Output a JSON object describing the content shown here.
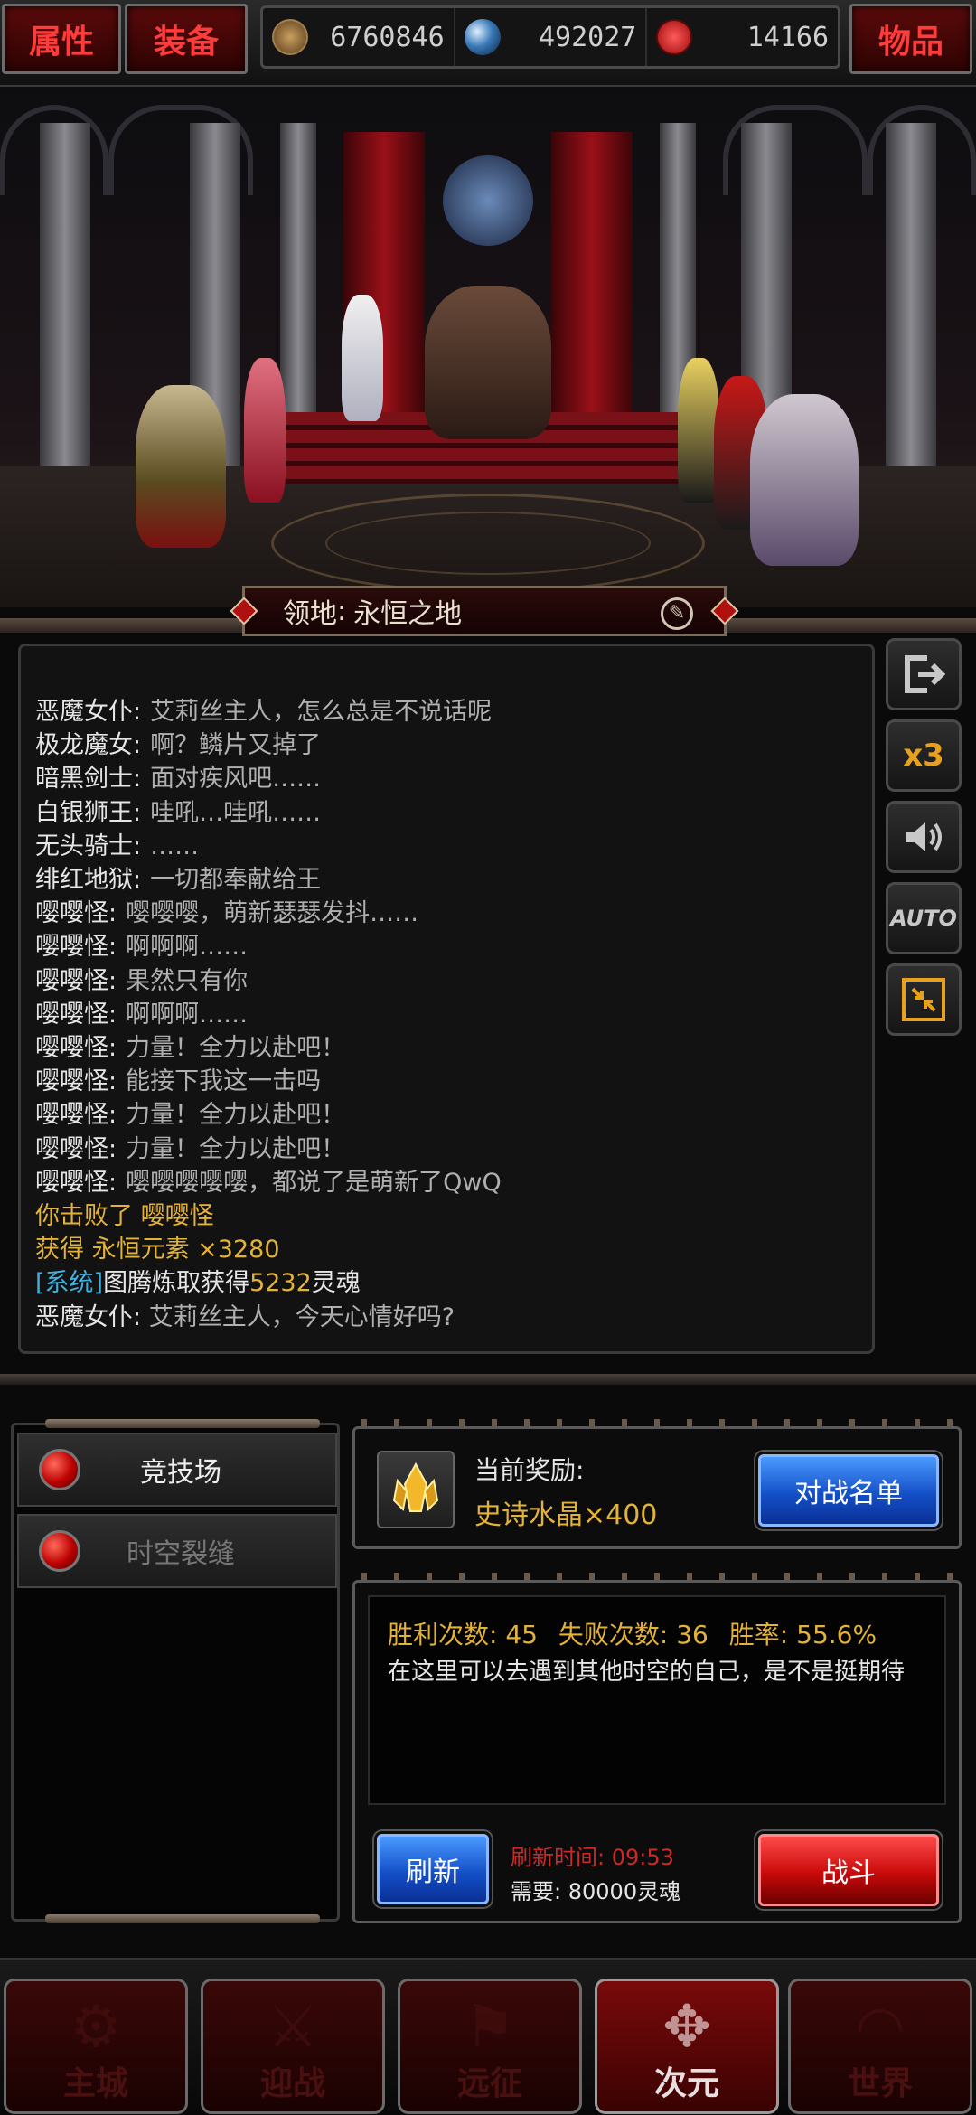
{
  "topbar": {
    "tab_attributes": "属性",
    "tab_equipment": "装备",
    "tab_items": "物品",
    "resources": [
      {
        "icon": "pentagram-coin-icon",
        "value": "6760846",
        "color": "#8a6a3a"
      },
      {
        "icon": "blue-gem-icon",
        "value": "492027",
        "color": "#3a7ab8"
      },
      {
        "icon": "red-soul-icon",
        "value": "14166",
        "color": "#c81818"
      }
    ]
  },
  "scene": {
    "territory_label": "领地",
    "territory_sep": ":",
    "territory_name": "永恒之地"
  },
  "chat": {
    "lines": [
      {
        "speaker": "恶魔女仆:",
        "text": "艾莉丝主人，怎么总是不说话呢"
      },
      {
        "speaker": "极龙魔女:",
        "text": "啊？鳞片又掉了"
      },
      {
        "speaker": "暗黑剑士:",
        "text": "面对疾风吧……"
      },
      {
        "speaker": "白银狮王:",
        "text": "哇吼…哇吼……"
      },
      {
        "speaker": "无头骑士:",
        "text": "……"
      },
      {
        "speaker": "绯红地狱:",
        "text": "一切都奉献给王"
      },
      {
        "speaker": "嘤嘤怪:",
        "text": "嘤嘤嘤，萌新瑟瑟发抖……"
      },
      {
        "speaker": "嘤嘤怪:",
        "text": "啊啊啊……"
      },
      {
        "speaker": "嘤嘤怪:",
        "text": "果然只有你"
      },
      {
        "speaker": "嘤嘤怪:",
        "text": "啊啊啊……"
      },
      {
        "speaker": "嘤嘤怪:",
        "text": "力量！全力以赴吧！"
      },
      {
        "speaker": "嘤嘤怪:",
        "text": "能接下我这一击吗"
      },
      {
        "speaker": "嘤嘤怪:",
        "text": "力量！全力以赴吧！"
      },
      {
        "speaker": "嘤嘤怪:",
        "text": "力量！全力以赴吧！"
      },
      {
        "speaker": "嘤嘤怪:",
        "text": "嘤嘤嘤嘤嘤，都说了是萌新了QwQ"
      }
    ],
    "defeat_text": "你击败了 嘤嘤怪",
    "loot_text": "获得 永恒元素 ×3280",
    "system_tag": "[系统]",
    "system_text": "图腾炼取获得",
    "system_value": "5232",
    "system_unit": "灵魂",
    "last_speaker": "恶魔女仆:",
    "last_text": "艾莉丝主人，今天心情好吗?"
  },
  "side_buttons": {
    "exit": "exit-icon",
    "speed": "x3",
    "sound": "speaker-icon",
    "auto": "AUTO",
    "collapse": "collapse-icon"
  },
  "modes": {
    "items": [
      {
        "label": "竞技场",
        "active": true
      },
      {
        "label": "时空裂缝",
        "active": false
      }
    ]
  },
  "reward": {
    "title": "当前奖励:",
    "item": "史诗水晶×400",
    "roster_button": "对战名单"
  },
  "stats": {
    "wins_label": "胜利次数:",
    "wins": "45",
    "losses_label": "失败次数:",
    "losses": "36",
    "rate_label": "胜率:",
    "rate": "55.6%",
    "description": "在这里可以去遇到其他时空的自己，是不是挺期待",
    "refresh_button": "刷新",
    "refresh_time_label": "刷新时间:",
    "refresh_time": "09:53",
    "cost_label": "需要:",
    "cost": "80000灵魂",
    "fight_button": "战斗"
  },
  "nav": {
    "items": [
      {
        "label": "主城",
        "active": false
      },
      {
        "label": "迎战",
        "active": false
      },
      {
        "label": "远征",
        "active": false
      },
      {
        "label": "次元",
        "active": true
      },
      {
        "label": "世界",
        "active": false
      }
    ]
  }
}
